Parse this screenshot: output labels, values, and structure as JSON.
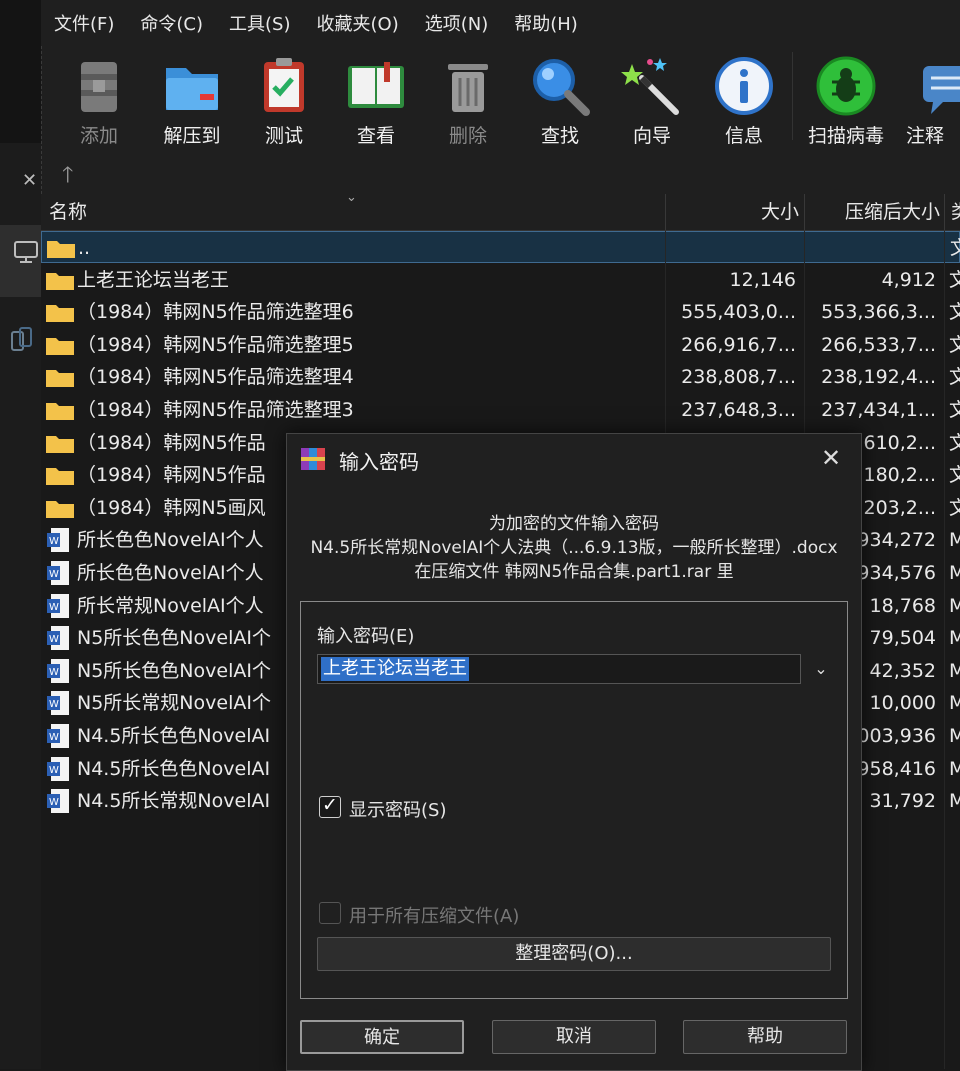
{
  "menu": [
    "文件(F)",
    "命令(C)",
    "工具(S)",
    "收藏夹(O)",
    "选项(N)",
    "帮助(H)"
  ],
  "toolbar": {
    "add": "添加",
    "extract": "解压到",
    "test": "测试",
    "view": "查看",
    "delete": "删除",
    "find": "查找",
    "wizard": "向导",
    "info": "信息",
    "virus": "扫描病毒",
    "comment": "注释"
  },
  "columns": {
    "name": "名称",
    "size": "大小",
    "packed": "压缩后大小",
    "type": "类"
  },
  "parent_row": {
    "name": "..",
    "type": "文"
  },
  "files": [
    {
      "name": "上老王论坛当老王",
      "size": "12,146",
      "packed": "4,912",
      "type": "文",
      "kind": "folder"
    },
    {
      "name": "（1984）韩网N5作品筛选整理6",
      "size": "555,403,0...",
      "packed": "553,366,3...",
      "type": "文",
      "kind": "folder"
    },
    {
      "name": "（1984）韩网N5作品筛选整理5",
      "size": "266,916,7...",
      "packed": "266,533,7...",
      "type": "文",
      "kind": "folder"
    },
    {
      "name": "（1984）韩网N5作品筛选整理4",
      "size": "238,808,7...",
      "packed": "238,192,4...",
      "type": "文",
      "kind": "folder"
    },
    {
      "name": "（1984）韩网N5作品筛选整理3",
      "size": "237,648,3...",
      "packed": "237,434,1...",
      "type": "文",
      "kind": "folder"
    },
    {
      "name": "（1984）韩网N5作品",
      "size": "",
      "packed": "610,2...",
      "type": "文",
      "kind": "folder"
    },
    {
      "name": "（1984）韩网N5作品",
      "size": "",
      "packed": "180,2...",
      "type": "文",
      "kind": "folder"
    },
    {
      "name": "（1984）韩网N5画风",
      "size": "",
      "packed": "203,2...",
      "type": "文",
      "kind": "folder"
    },
    {
      "name": "所长色色NovelAI个人",
      "size": "",
      "packed": "934,272",
      "type": "M",
      "kind": "docx"
    },
    {
      "name": "所长色色NovelAI个人",
      "size": "",
      "packed": "934,576",
      "type": "M",
      "kind": "docx"
    },
    {
      "name": "所长常规NovelAI个人",
      "size": "",
      "packed": "18,768",
      "type": "M",
      "kind": "docx"
    },
    {
      "name": "N5所长色色NovelAI个",
      "size": "",
      "packed": "79,504",
      "type": "M",
      "kind": "docx"
    },
    {
      "name": "N5所长色色NovelAI个",
      "size": "",
      "packed": "42,352",
      "type": "M",
      "kind": "docx"
    },
    {
      "name": "N5所长常规NovelAI个",
      "size": "",
      "packed": "10,000",
      "type": "M",
      "kind": "docx"
    },
    {
      "name": "N4.5所长色色NovelAI",
      "size": "",
      "packed": "003,936",
      "type": "M",
      "kind": "docx"
    },
    {
      "name": "N4.5所长色色NovelAI",
      "size": "",
      "packed": "958,416",
      "type": "M",
      "kind": "docx"
    },
    {
      "name": "N4.5所长常规NovelAI",
      "size": "",
      "packed": "31,792",
      "type": "M",
      "kind": "docx"
    }
  ],
  "dialog": {
    "title": "输入密码",
    "line1": "为加密的文件输入密码",
    "line2": "N4.5所长常规NovelAI个人法典（...6.9.13版，一般所长整理）.docx",
    "line3": "在压缩文件 韩网N5作品合集.part1.rar 里",
    "password_label": "输入密码(E)",
    "password_value": "上老王论坛当老王",
    "show_password": "显示密码(S)",
    "show_password_checked": true,
    "use_all": "用于所有压缩文件(A)",
    "use_all_checked": false,
    "organize": "整理密码(O)...",
    "ok": "确定",
    "cancel": "取消",
    "help": "帮助"
  }
}
